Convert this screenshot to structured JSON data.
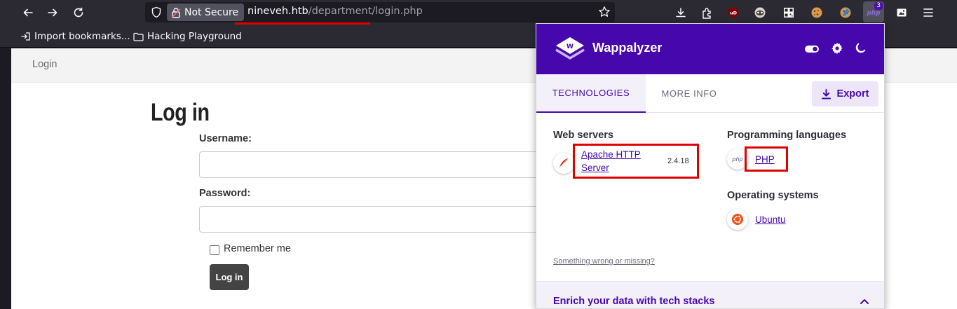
{
  "browser": {
    "security_label": "Not Secure",
    "url_host": "nineveh.htb",
    "url_path": "/department/login.php",
    "wappalyzer_badge": "3",
    "bookmarks": [
      {
        "label": "Import bookmarks..."
      },
      {
        "label": "Hacking Playground"
      }
    ],
    "toolbar_icons": [
      "download-icon",
      "extensions-icon",
      "ublock-icon",
      "privacy-badger-icon",
      "qr-code-icon",
      "cookie-icon",
      "cookie-editor-icon",
      "wappalyzer-icon",
      "screenshot-icon",
      "menu-icon"
    ]
  },
  "page": {
    "nav_title": "Login",
    "heading": "Log in",
    "username_label": "Username:",
    "password_label": "Password:",
    "remember_label": "Remember me",
    "submit_label": "Log in"
  },
  "wappalyzer": {
    "title": "Wappalyzer",
    "tabs": [
      {
        "label": "TECHNOLOGIES",
        "active": true
      },
      {
        "label": "MORE INFO",
        "active": false
      }
    ],
    "export_label": "Export",
    "categories": [
      {
        "name": "Web servers",
        "technologies": [
          {
            "name": "Apache HTTP Server",
            "version": "2.4.18"
          }
        ]
      },
      {
        "name": "Programming languages",
        "technologies": [
          {
            "name": "PHP",
            "icon_text": "php"
          }
        ]
      },
      {
        "name": "Operating systems",
        "technologies": [
          {
            "name": "Ubuntu"
          }
        ]
      }
    ],
    "feedback_link": "Something wrong or missing?",
    "enrich_title": "Enrich your data with tech stacks",
    "colors": {
      "brand": "#4608ad",
      "highlight_box": "#e00000"
    }
  }
}
